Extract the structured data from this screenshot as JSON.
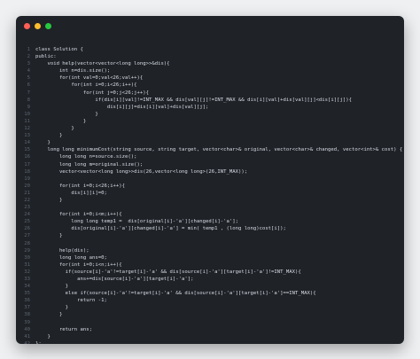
{
  "window": {
    "controls": [
      "close",
      "minimize",
      "maximize"
    ]
  },
  "code_lines": [
    "class Solution {",
    "public:",
    "    void help(vector<vector<long long>>&dis){",
    "        int n=dis.size();",
    "        for(int val=0;val<26;val++){",
    "            for(int i=0;i<26;i++){",
    "                for(int j=0;j<26;j++){",
    "                    if(dis[i][val]!=INT_MAX && dis[val][j]!=INT_MAX && dis[i][val]+dis[val][j]<dis[i][j]){",
    "                        dis[i][j]=dis[i][val]+dis[val][j];",
    "                    }",
    "                }",
    "            }",
    "        }",
    "    }",
    "    long long minimumCost(string source, string target, vector<char>& original, vector<char>& changed, vector<int>& cost) {",
    "        long long n=source.size();",
    "        long long m=original.size();",
    "        vector<vector<long long>>dis(26,vector<long long>(26,INT_MAX));",
    "",
    "        for(int i=0;i<26;i++){",
    "            dis[i][i]=0;",
    "        }",
    "",
    "        for(int i=0;i<m;i++){",
    "            long long temp1 =  dis[original[i]-'a'][changed[i]-'a'];",
    "            dis[original[i]-'a'][changed[i]-'a'] = min( temp1 , (long long)cost[i]);",
    "        }",
    "",
    "        help(dis);",
    "        long long ans=0;",
    "        for(int i=0;i<n;i++){",
    "          if(source[i]-'a'!=target[i]-'a' && dis[source[i]-'a'][target[i]-'a']!=INT_MAX){",
    "              ans+=dis[source[i]-'a'][target[i]-'a'];",
    "          }",
    "          else if(source[i]-'a'!=target[i]-'a' && dis[source[i]-'a'][target[i]-'a']==INT_MAX){",
    "              return -1;",
    "          }",
    "        }",
    "",
    "        return ans;",
    "    }",
    "};"
  ]
}
